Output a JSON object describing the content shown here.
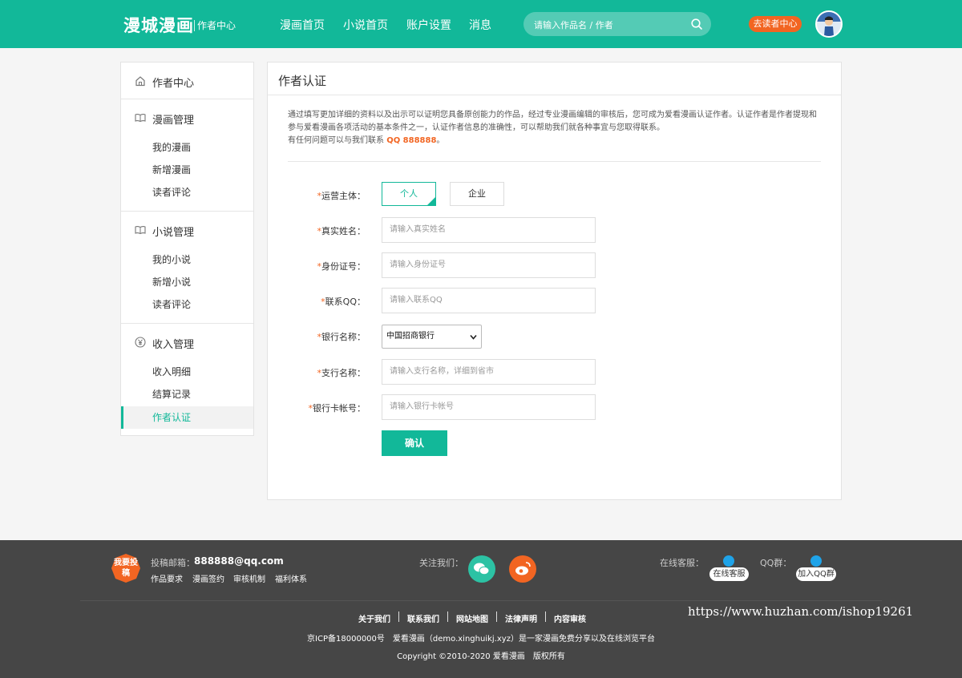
{
  "header": {
    "logo": "漫城漫画",
    "logo_sub": "作者中心",
    "nav": [
      "漫画首页",
      "小说首页",
      "账户设置",
      "消息"
    ],
    "search_placeholder": "请输入作品名 / 作者",
    "reader_button": "去读者中心"
  },
  "sidebar": {
    "home": "作者中心",
    "comic": {
      "title": "漫画管理",
      "items": [
        "我的漫画",
        "新增漫画",
        "读者评论"
      ]
    },
    "novel": {
      "title": "小说管理",
      "items": [
        "我的小说",
        "新增小说",
        "读者评论"
      ]
    },
    "income": {
      "title": "收入管理",
      "items": [
        "收入明细",
        "结算记录",
        "作者认证"
      ]
    }
  },
  "main": {
    "title": "作者认证",
    "intro_line1": "通过填写更加详细的资料以及出示可以证明您具备原创能力的作品，经过专业漫画编辑的审核后，您可成为爱看漫画认证作者。认证作者是作者提现和",
    "intro_line2": "参与爱看漫画各项活动的基本条件之一，认证作者信息的准确性，可以帮助我们就各种事宜与您取得联系。",
    "intro_line3_prefix": "有任何问题可以与我们联系",
    "intro_qq": "QQ 888888",
    "intro_line3_suffix": "。",
    "form": {
      "entity_label": "运营主体：",
      "entity_options": [
        "个人",
        "企业"
      ],
      "name_label": "真实姓名：",
      "name_placeholder": "请输入真实姓名",
      "id_label": "身份证号：",
      "id_placeholder": "请输入身份证号",
      "qq_label": "联系QQ：",
      "qq_placeholder": "请输入联系QQ",
      "bank_label": "银行名称：",
      "bank_selected": "中国招商银行",
      "branch_label": "支行名称：",
      "branch_placeholder": "请输入支行名称，详细到省市",
      "card_label": "银行卡帐号：",
      "card_placeholder": "请输入银行卡帐号",
      "required_mark": "*",
      "submit": "确认"
    }
  },
  "footer": {
    "badge": "我要投稿",
    "mail_label": "投稿邮箱：",
    "mail_value": "888888@qq.com",
    "links": [
      "作品要求",
      "漫画签约",
      "审核机制",
      "福利体系"
    ],
    "follow_label": "关注我们：",
    "service_label": "在线客服：",
    "service_btn": "在线客服",
    "qq_group_label": "QQ群：",
    "qq_group_btn": "加入QQ群",
    "watermark": "https://www.huzhan.com/ishop19261",
    "bottom_links": [
      "关于我们",
      "联系我们",
      "网站地图",
      "法律声明",
      "内容审核"
    ],
    "icp": "京ICP备18000000号　爱看漫画（demo.xinghuikj.xyz）是一家漫画免费分享以及在线浏览平台",
    "copyright": "Copyright ©2010-2020 爱看漫画　版权所有"
  },
  "colors": {
    "brand": "#12b899",
    "accent": "#f26522",
    "footer_bg": "#464646"
  }
}
